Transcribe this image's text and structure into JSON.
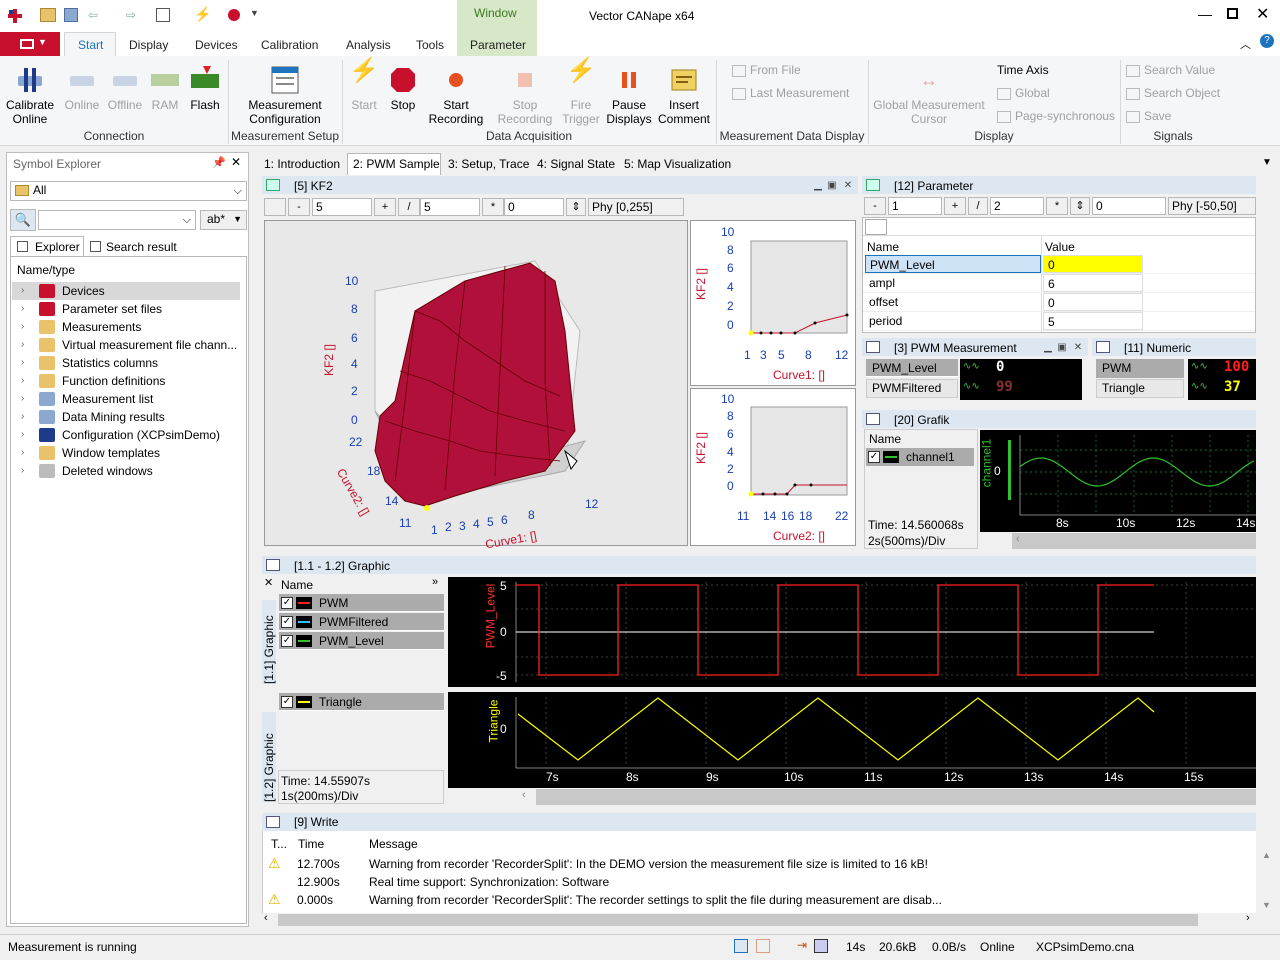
{
  "app": {
    "title": "Vector CANape x64",
    "context_tab": "Window"
  },
  "ribbon_tabs": [
    "Start",
    "Display",
    "Devices",
    "Calibration",
    "Analysis",
    "Tools",
    "Parameter"
  ],
  "ribbon": {
    "connection": {
      "label": "Connection",
      "calibrate": "Calibrate\nOnline",
      "online": "Online",
      "offline": "Offline",
      "ram": "RAM",
      "flash": "Flash"
    },
    "measurement_setup": {
      "label": "Measurement Setup",
      "config": "Measurement\nConfiguration"
    },
    "data_acquisition": {
      "label": "Data Acquisition",
      "start": "Start",
      "stop": "Stop",
      "start_rec": "Start\nRecording",
      "stop_rec": "Stop\nRecording",
      "fire": "Fire\nTrigger",
      "pause": "Pause\nDisplays",
      "insert": "Insert\nComment"
    },
    "mdd": {
      "label": "Measurement Data Display",
      "from_file": "From File",
      "last": "Last Measurement"
    },
    "display": {
      "label": "Display",
      "cursor": "Global Measurement\nCursor",
      "time_axis": "Time Axis",
      "global": "Global",
      "page_sync": "Page-synchronous"
    },
    "signals": {
      "label": "Signals",
      "search_value": "Search Value",
      "search_object": "Search Object",
      "save": "Save"
    }
  },
  "symbol_explorer": {
    "title": "Symbol Explorer",
    "filter": "All",
    "search_value": "",
    "search_opt": "ab*",
    "tabs": [
      "Explorer",
      "Search result"
    ],
    "column": "Name/type",
    "items": [
      "Devices",
      "Parameter set files",
      "Measurements",
      "Virtual measurement file chann...",
      "Statistics columns",
      "Function definitions",
      "Measurement list",
      "Data Mining results",
      "Configuration (XCPsimDemo)",
      "Window templates",
      "Deleted windows"
    ]
  },
  "page_tabs": [
    "1: Introduction",
    "2: PWM Sample",
    "3: Setup, Trace",
    "4: Signal State",
    "5: Map Visualization"
  ],
  "kf2": {
    "title": "[5] KF2",
    "v1": "5",
    "v2": "5",
    "v3": "0",
    "phy": "Phy [0,255]",
    "z_ticks": [
      "10",
      "8",
      "6",
      "4",
      "2",
      "0"
    ],
    "z_label": "KF2 []",
    "y_ticks": [
      "22",
      "18",
      "14",
      "11"
    ],
    "y_label": "Curve2: []",
    "x_ticks": [
      "1",
      "2",
      "3",
      "4",
      "5",
      "6",
      "8",
      "12"
    ],
    "x_label": "Curve1: []"
  },
  "curve1": {
    "y_ticks": [
      "10",
      "8",
      "6",
      "4",
      "2",
      "0"
    ],
    "ylabel": "KF2 []",
    "x_ticks": [
      "1",
      "3",
      "5",
      "8",
      "12"
    ],
    "xlabel": "Curve1: []"
  },
  "curve2": {
    "y_ticks": [
      "10",
      "8",
      "6",
      "4",
      "2",
      "0"
    ],
    "ylabel": "KF2 []",
    "x_ticks": [
      "11",
      "14",
      "16",
      "18",
      "22"
    ],
    "xlabel": "Curve2: []"
  },
  "parameter": {
    "title": "[12] Parameter",
    "v1": "1",
    "v2": "2",
    "v3": "0",
    "phy": "Phy [-50,50]",
    "col_name": "Name",
    "col_value": "Value",
    "rows": [
      {
        "name": "PWM_Level",
        "value": "0"
      },
      {
        "name": "ampl",
        "value": "6"
      },
      {
        "name": "offset",
        "value": "0"
      },
      {
        "name": "period",
        "value": "5"
      }
    ]
  },
  "pwm_meas": {
    "title": "[3] PWM Measurement",
    "rows": [
      {
        "name": "PWM_Level",
        "value": "0"
      },
      {
        "name": "PWMFiltered",
        "value": "99"
      }
    ]
  },
  "numeric": {
    "title": "[11] Numeric",
    "rows": [
      {
        "name": "PWM",
        "value": "100"
      },
      {
        "name": "Triangle",
        "value": "37"
      }
    ]
  },
  "grafik": {
    "title": "[20] Grafik",
    "col": "Name",
    "channel": "channel1",
    "time": "Time: 14.560068s",
    "div": "2s(500ms)/Div",
    "ylabel": "channel1",
    "y0": "0",
    "x_ticks": [
      "8s",
      "10s",
      "12s",
      "14s"
    ]
  },
  "graphic": {
    "title": "[1.1 - 1.2] Graphic",
    "col": "Name",
    "signals_top": [
      "PWM",
      "PWMFiltered",
      "PWM_Level"
    ],
    "signal_bottom": "Triangle",
    "tab_top": "[1.1] Graphic",
    "tab_bottom": "[1.2] Graphic",
    "top_ylabel": "PWM_Level",
    "top_y": [
      "5",
      "0",
      "-5"
    ],
    "bot_ylabel": "Triangle",
    "bot_y0": "0",
    "time": "Time: 14.55907s",
    "div": "1s(200ms)/Div",
    "x_ticks": [
      "7s",
      "8s",
      "9s",
      "10s",
      "11s",
      "12s",
      "13s",
      "14s",
      "15s"
    ]
  },
  "write": {
    "title": "[9] Write",
    "cols": [
      "T...",
      "Time",
      "Message"
    ],
    "rows": [
      {
        "warn": true,
        "time": "12.700s",
        "msg": "Warning from recorder 'RecorderSplit': In the DEMO version the measurement file size is limited to 16 kB!"
      },
      {
        "warn": false,
        "time": "12.900s",
        "msg": "Real time support: Synchronization: Software"
      },
      {
        "warn": true,
        "time": "0.000s",
        "msg": "Warning from recorder 'RecorderSplit': The recorder settings to split the file during measurement are disab..."
      }
    ]
  },
  "status": {
    "text": "Measurement is running",
    "time": "14s",
    "size": "20.6kB",
    "rate": "0.0B/s",
    "mode": "Online",
    "file": "XCPsimDemo.cna"
  },
  "colors": {
    "accent": "#1e73be",
    "file_tab": "#c8102e",
    "window_ctx": "#d7e8c8",
    "surface": "#b0103a",
    "pwm_red": "#ff2020",
    "triangle_yellow": "#ffff00",
    "grafik_green": "#30c030"
  }
}
